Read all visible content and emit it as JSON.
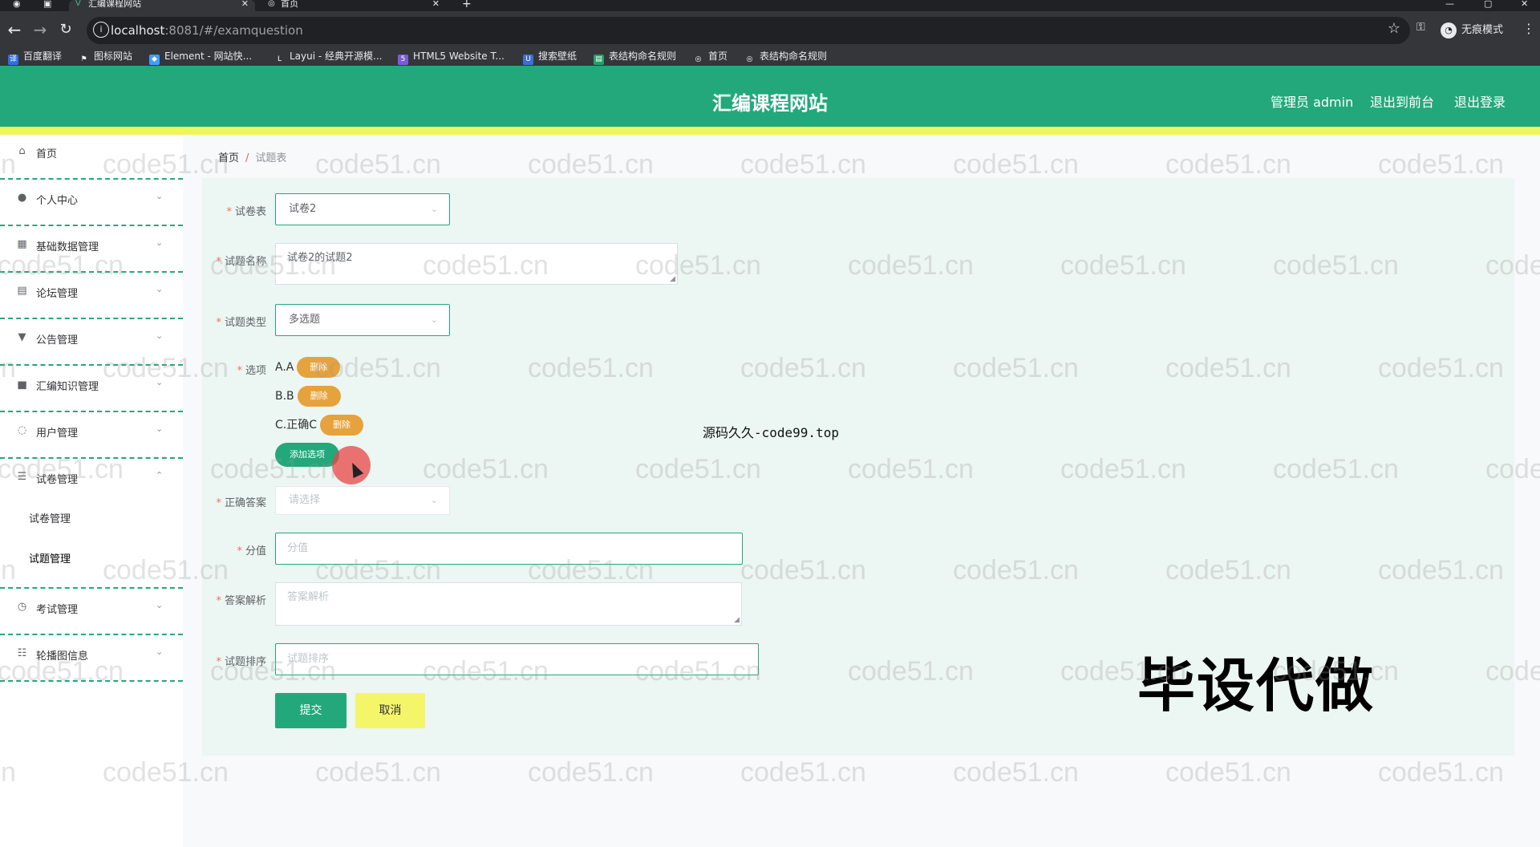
{
  "browser": {
    "tabs": [
      {
        "title": "汇编课程网站",
        "active": true
      },
      {
        "title": "首页",
        "active": false
      }
    ],
    "url_host": "localhost",
    "url_path": ":8081/#/examquestion",
    "incognito_label": "无痕模式",
    "bookmarks": [
      "百度翻译",
      "图标网站",
      "Element - 网站快...",
      "Layui - 经典开源模...",
      "HTML5 Website T...",
      "搜索壁纸",
      "表结构命名规则",
      "首页",
      "表结构命名规则"
    ]
  },
  "header": {
    "title": "汇编课程网站",
    "admin_label": "管理员 admin",
    "back_to_front": "退出到前台",
    "logout": "退出登录",
    "color": "#23a87b"
  },
  "sidebar": {
    "items": [
      {
        "label": "首页",
        "icon": "home-icon"
      },
      {
        "label": "个人中心",
        "icon": "user-icon"
      },
      {
        "label": "基础数据管理",
        "icon": "data-icon"
      },
      {
        "label": "论坛管理",
        "icon": "forum-icon"
      },
      {
        "label": "公告管理",
        "icon": "notice-icon"
      },
      {
        "label": "汇编知识管理",
        "icon": "knowledge-icon"
      },
      {
        "label": "用户管理",
        "icon": "users-icon"
      },
      {
        "label": "试卷管理",
        "icon": "list-icon"
      },
      {
        "label": "考试管理",
        "icon": "clock-icon"
      },
      {
        "label": "轮播图信息",
        "icon": "sliders-icon"
      }
    ],
    "subitems": [
      "试卷管理",
      "试题管理"
    ]
  },
  "breadcrumb": {
    "home": "首页",
    "sep": "/",
    "current": "试题表"
  },
  "form": {
    "paper_label": "试卷表",
    "paper_value": "试卷2",
    "name_label": "试题名称",
    "name_value": "试卷2的试题2",
    "type_label": "试题类型",
    "type_value": "多选题",
    "options_label": "选项",
    "options": [
      "A.A",
      "B.B",
      "C.正确C"
    ],
    "delete_label": "删除",
    "add_option_label": "添加选项",
    "answer_label": "正确答案",
    "answer_placeholder": "请选择",
    "score_label": "分值",
    "score_placeholder": "分值",
    "analysis_label": "答案解析",
    "analysis_placeholder": "答案解析",
    "order_label": "试题排序",
    "order_placeholder": "试题排序",
    "submit_label": "提交",
    "cancel_label": "取消"
  },
  "overlay": {
    "source_text": "源码久久-code99.top",
    "promo_text": "毕设代做"
  },
  "watermark": "code51.cn"
}
